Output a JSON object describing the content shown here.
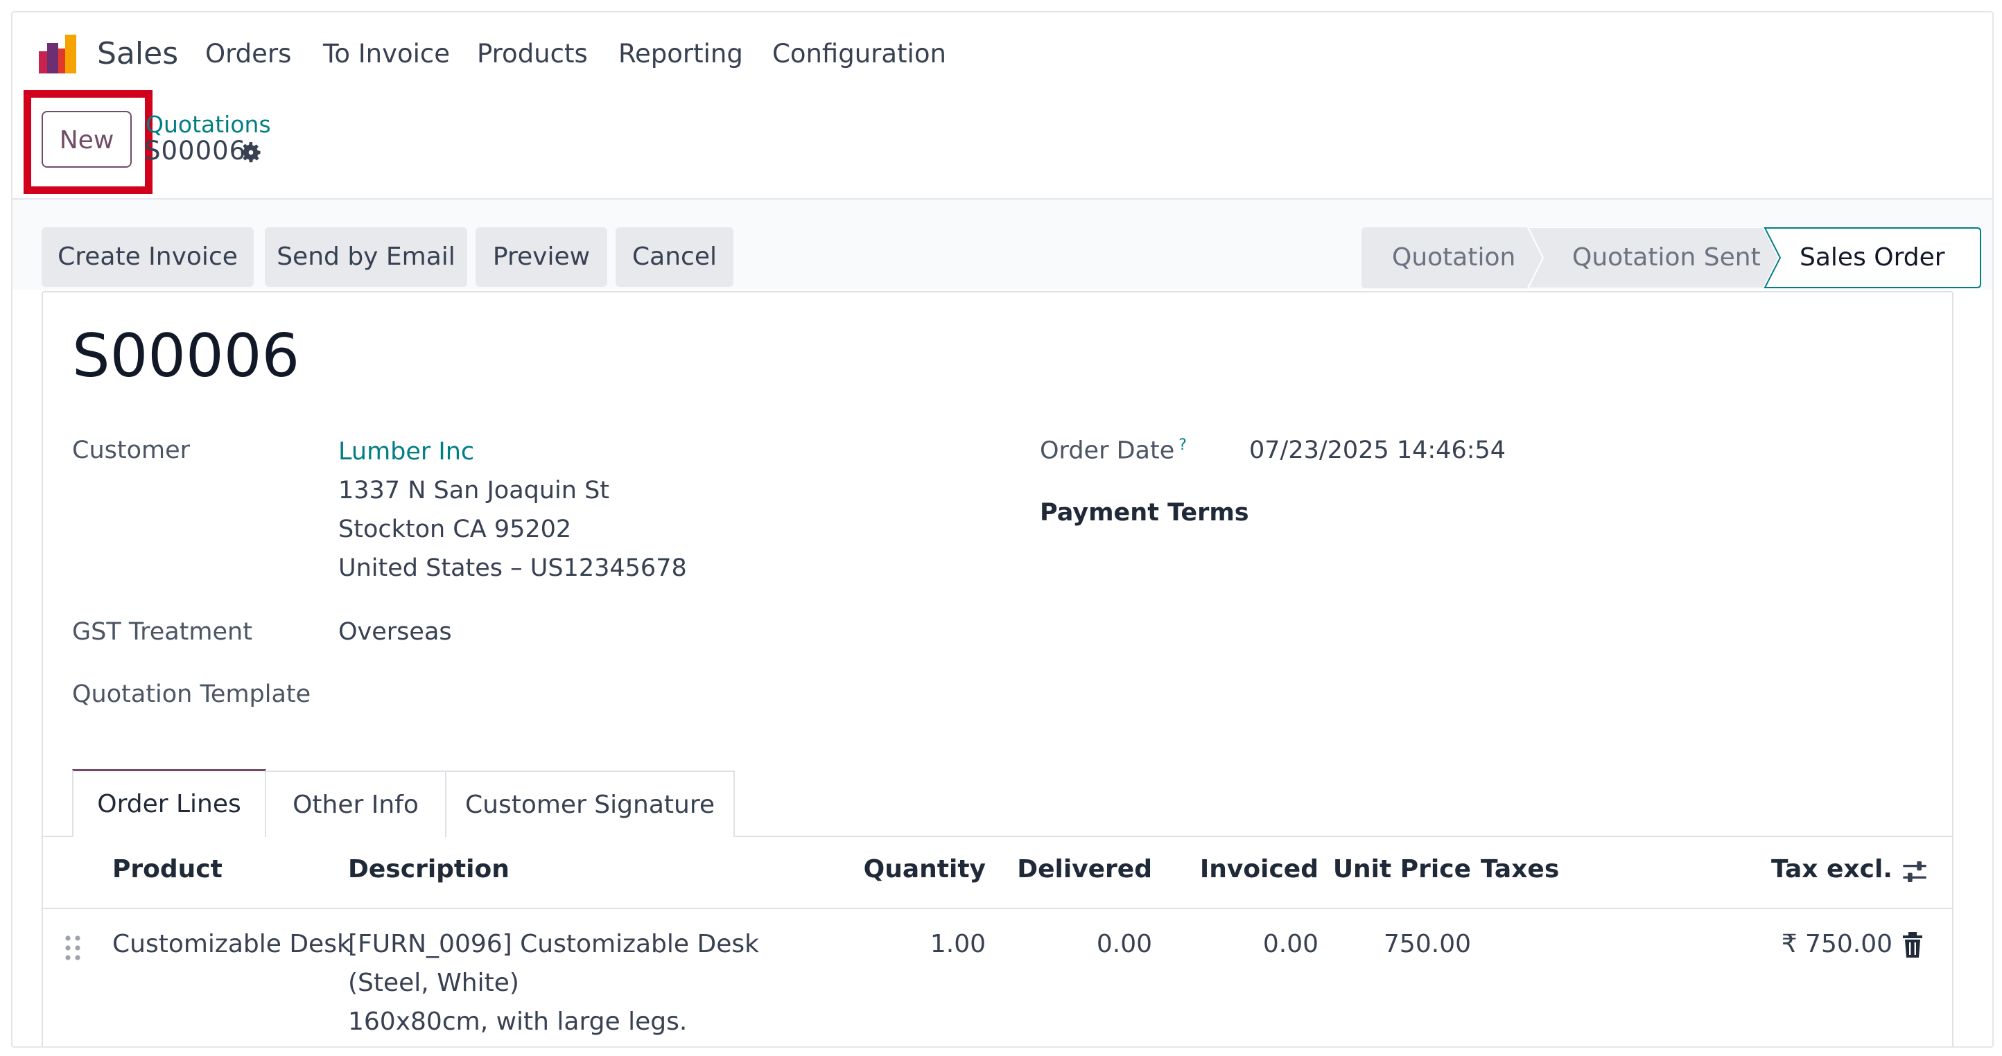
{
  "nav": {
    "app_name": "Sales",
    "items": [
      "Orders",
      "To Invoice",
      "Products",
      "Reporting",
      "Configuration"
    ]
  },
  "control": {
    "new_label": "New",
    "breadcrumb_parent": "Quotations",
    "breadcrumb_current": "S00006"
  },
  "actions": [
    "Create Invoice",
    "Send by Email",
    "Preview",
    "Cancel"
  ],
  "stages": [
    {
      "label": "Quotation",
      "active": false
    },
    {
      "label": "Quotation Sent",
      "active": false
    },
    {
      "label": "Sales Order",
      "active": true
    }
  ],
  "record": {
    "name": "S00006",
    "customer_label": "Customer",
    "customer_name": "Lumber Inc",
    "address_line1": "1337 N San Joaquin St",
    "address_line2": "Stockton CA 95202",
    "address_line3": "United States – US12345678",
    "gst_label": "GST Treatment",
    "gst_value": "Overseas",
    "template_label": "Quotation Template",
    "order_date_label": "Order Date",
    "order_date_help": "?",
    "order_date_value": "07/23/2025 14:46:54",
    "payment_terms_label": "Payment Terms"
  },
  "tabs": [
    "Order Lines",
    "Other Info",
    "Customer Signature"
  ],
  "table": {
    "headers": {
      "product": "Product",
      "description": "Description",
      "quantity": "Quantity",
      "delivered": "Delivered",
      "invoiced": "Invoiced",
      "unit_price": "Unit Price",
      "taxes": "Taxes",
      "tax_excl": "Tax excl."
    },
    "rows": [
      {
        "product": "Customizable Desk",
        "description_lines": [
          "[FURN_0096] Customizable Desk",
          "(Steel, White)",
          "160x80cm, with large legs."
        ],
        "quantity": "1.00",
        "delivered": "0.00",
        "invoiced": "0.00",
        "unit_price": "750.00",
        "taxes": "",
        "tax_excl": "₹ 750.00"
      }
    ]
  },
  "colors": {
    "brand": "#714b67",
    "link": "#017e84",
    "highlight": "#d1001c"
  },
  "icons": [
    "odoo-sales-logo",
    "gear-icon",
    "drag-handle-icon",
    "trash-icon",
    "optional-columns-icon"
  ]
}
